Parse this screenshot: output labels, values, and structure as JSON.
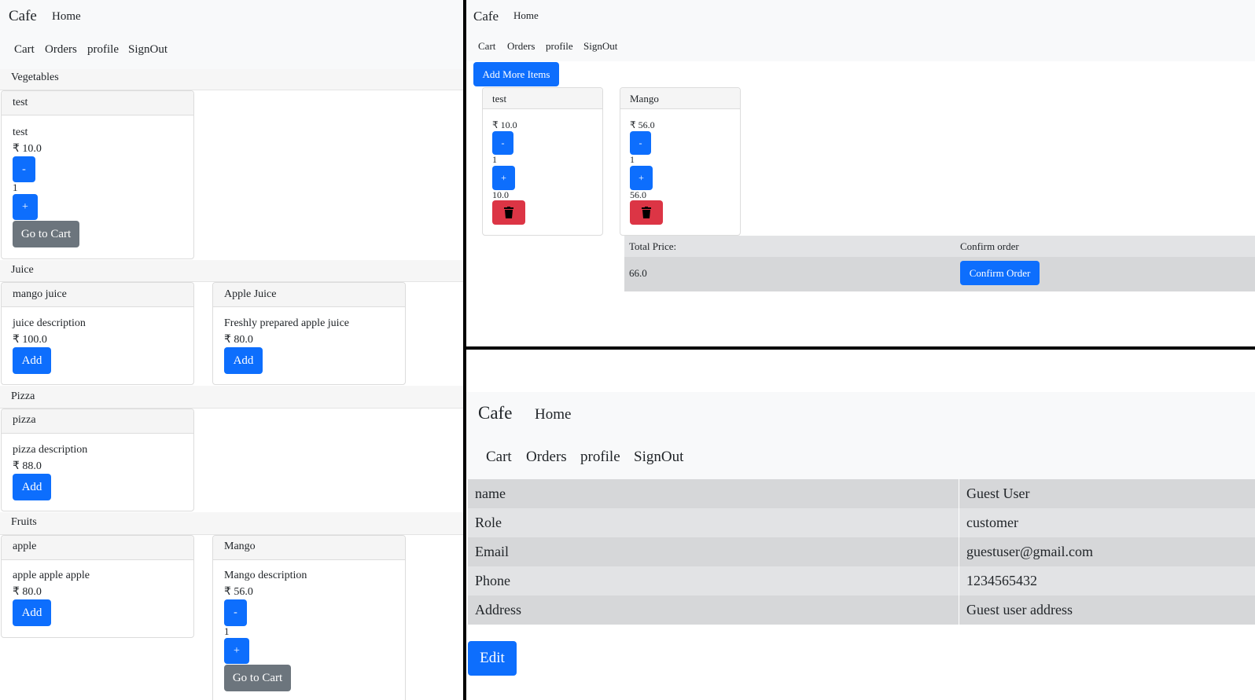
{
  "nav": {
    "brand": "Cafe",
    "home": "Home",
    "cart": "Cart",
    "orders": "Orders",
    "profile": "profile",
    "signout": "SignOut"
  },
  "menu": {
    "currency": "₹",
    "categories": [
      {
        "name": "Vegetables",
        "items": [
          {
            "title": "test",
            "description": "test",
            "price": "₹ 10.0",
            "minus": "-",
            "qty": "1",
            "plus": "+",
            "goto": "Go to Cart"
          }
        ]
      },
      {
        "name": "Juice",
        "items": [
          {
            "title": "mango juice",
            "description": "juice description",
            "price": "₹ 100.0",
            "add": "Add"
          },
          {
            "title": "Apple Juice",
            "description": "Freshly prepared apple juice",
            "price": "₹ 80.0",
            "add": "Add"
          }
        ]
      },
      {
        "name": "Pizza",
        "items": [
          {
            "title": "pizza",
            "description": "pizza description",
            "price": "₹ 88.0",
            "add": "Add"
          }
        ]
      },
      {
        "name": "Fruits",
        "items": [
          {
            "title": "apple",
            "description": "apple apple apple",
            "price": "₹ 80.0",
            "add": "Add"
          },
          {
            "title": "Mango",
            "description": "Mango description",
            "price": "₹ 56.0",
            "minus": "-",
            "qty": "1",
            "plus": "+",
            "goto": "Go to Cart"
          }
        ]
      }
    ]
  },
  "cart": {
    "add_more": "Add More Items",
    "items": [
      {
        "title": "test",
        "price": "₹ 10.0",
        "minus": "-",
        "qty": "1",
        "plus": "+",
        "subtotal": "10.0",
        "delete_icon": "trash-icon"
      },
      {
        "title": "Mango",
        "price": "₹ 56.0",
        "minus": "-",
        "qty": "1",
        "plus": "+",
        "subtotal": "56.0",
        "delete_icon": "trash-icon"
      }
    ],
    "total_label": "Total Price:",
    "confirm_header": "Confirm order",
    "total_value": "66.0",
    "confirm_button": "Confirm Order"
  },
  "profile": {
    "rows": [
      {
        "label": "name",
        "value": "Guest User"
      },
      {
        "label": "Role",
        "value": "customer"
      },
      {
        "label": "Email",
        "value": "guestuser@gmail.com"
      },
      {
        "label": "Phone",
        "value": "1234565432"
      },
      {
        "label": "Address",
        "value": "Guest user address"
      }
    ],
    "edit": "Edit"
  },
  "colors": {
    "primary": "#0d6efd",
    "secondary": "#6c757d",
    "danger": "#dc3545",
    "navbar": "#f8f9fa"
  }
}
